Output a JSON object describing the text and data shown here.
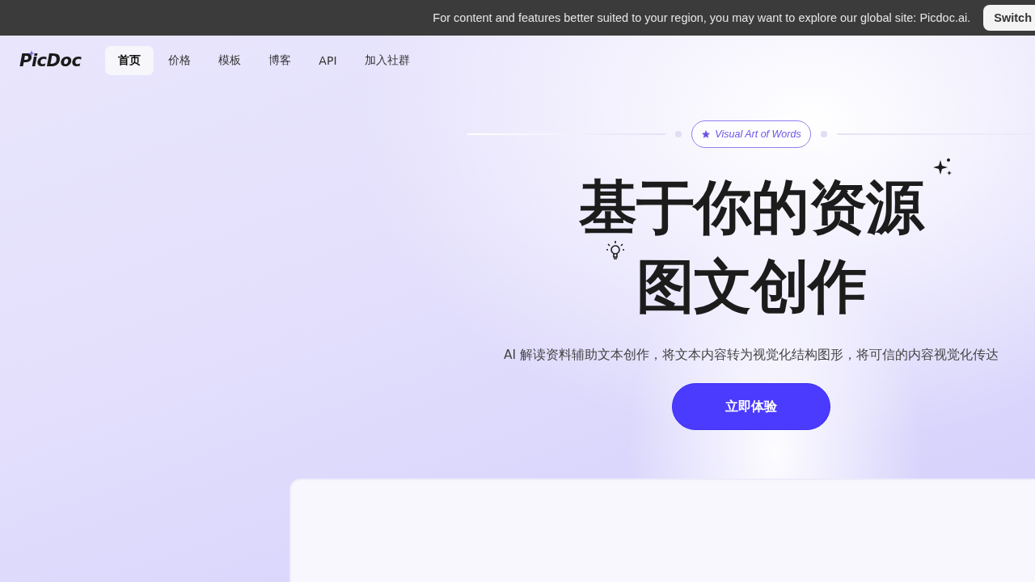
{
  "notice_bar": {
    "message": "For content and features better suited to your region, you may want to explore our global site: Picdoc.ai.",
    "button": "Switch"
  },
  "nav": {
    "logo": "PicDoc",
    "items": [
      {
        "label": "首页",
        "selected": true
      },
      {
        "label": "价格",
        "selected": false
      },
      {
        "label": "模板",
        "selected": false
      },
      {
        "label": "博客",
        "selected": false
      },
      {
        "label": "API",
        "selected": false
      },
      {
        "label": "加入社群",
        "selected": false
      }
    ]
  },
  "hero": {
    "badge": "Visual Art of Words",
    "title_lines": [
      "基于你的资源",
      "图文创作"
    ],
    "subtitle": "AI 解读资料辅助文本创作，将文本内容转为视觉化结构图形，将可信的内容视觉化传达",
    "cta": "立即体验"
  }
}
